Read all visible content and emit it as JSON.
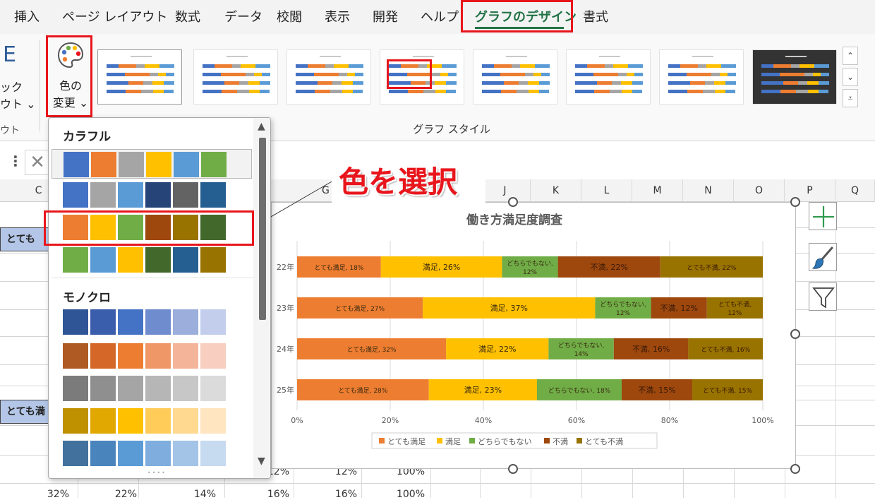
{
  "ribbon_tabs": [
    "挿入",
    "ページ レイアウト",
    "数式",
    "データ",
    "校閲",
    "表示",
    "開発",
    "ヘルプ",
    "グラフのデザイン",
    "書式"
  ],
  "ribbon_tabs_active": "グラフのデザイン",
  "ribbon": {
    "left_cut": {
      "line1": "ック",
      "line2": "ウト ⌄",
      "line3": "ウト",
      "glyph": "E"
    },
    "change_colors": {
      "line1": "色の",
      "line2": "変更 ⌄",
      "icon": "palette-icon"
    },
    "chart_styles_label": "グラフ スタイル"
  },
  "color_dropdown": {
    "section_colorful": "カラフル",
    "section_mono": "モノクロ",
    "colorful_rows": [
      [
        "#4472C4",
        "#ED7D31",
        "#A5A5A5",
        "#FFC000",
        "#5B9BD5",
        "#70AD47"
      ],
      [
        "#4472C4",
        "#A5A5A5",
        "#5B9BD5",
        "#264478",
        "#636363",
        "#255E91"
      ],
      [
        "#ED7D31",
        "#FFC000",
        "#70AD47",
        "#9E480E",
        "#997300",
        "#43682B"
      ],
      [
        "#70AD47",
        "#5B9BD5",
        "#FFC000",
        "#43682B",
        "#255E91",
        "#997300"
      ]
    ],
    "mono_rows": [
      [
        "#2F5597",
        "#3A5EAB",
        "#4472C4",
        "#6F8CCF",
        "#9BAEDC",
        "#C2CEEB"
      ],
      [
        "#B05A23",
        "#D56828",
        "#ED7D31",
        "#F09768",
        "#F4B49A",
        "#F8CEC0"
      ],
      [
        "#7B7B7B",
        "#8F8F8F",
        "#A5A5A5",
        "#B6B6B6",
        "#C7C7C7",
        "#DBDBDB"
      ],
      [
        "#BF9000",
        "#E0A800",
        "#FFC000",
        "#FFCC5A",
        "#FFD990",
        "#FFE6C0"
      ],
      [
        "#41719C",
        "#4A84BD",
        "#5B9BD5",
        "#7EADDE",
        "#A3C3E7",
        "#C6DAF0"
      ]
    ]
  },
  "annotation": "色を選択",
  "grid": {
    "columns": [
      "C",
      "G",
      "J",
      "K",
      "L",
      "M",
      "N",
      "O",
      "P",
      "Q"
    ],
    "cells": [
      "とても",
      "とても満",
      "32%",
      "22%",
      "14%",
      "16%",
      "16%",
      "100%",
      "12%",
      "12%",
      "100%"
    ]
  },
  "chart_data": {
    "type": "bar",
    "orientation": "horizontal",
    "stacked": "percent",
    "title": "働き方満足度調査",
    "categories": [
      "22年",
      "23年",
      "24年",
      "25年"
    ],
    "series": [
      {
        "name": "とても満足",
        "color": "#ED7D31",
        "values": [
          18,
          27,
          32,
          28
        ]
      },
      {
        "name": "満足",
        "color": "#FFC000",
        "values": [
          26,
          37,
          22,
          23
        ]
      },
      {
        "name": "どちらでもない",
        "color": "#70AD47",
        "values": [
          12,
          12,
          14,
          18
        ]
      },
      {
        "name": "不満",
        "color": "#9E480E",
        "values": [
          22,
          12,
          16,
          15
        ]
      },
      {
        "name": "とても不満",
        "color": "#997300",
        "values": [
          22,
          12,
          16,
          15
        ]
      }
    ],
    "xticks": [
      "0%",
      "20%",
      "40%",
      "60%",
      "80%",
      "100%"
    ],
    "xlim": [
      0,
      100
    ],
    "legend_position": "bottom",
    "grid": true
  },
  "side_buttons": [
    "plus-icon",
    "brush-icon",
    "filter-icon"
  ]
}
